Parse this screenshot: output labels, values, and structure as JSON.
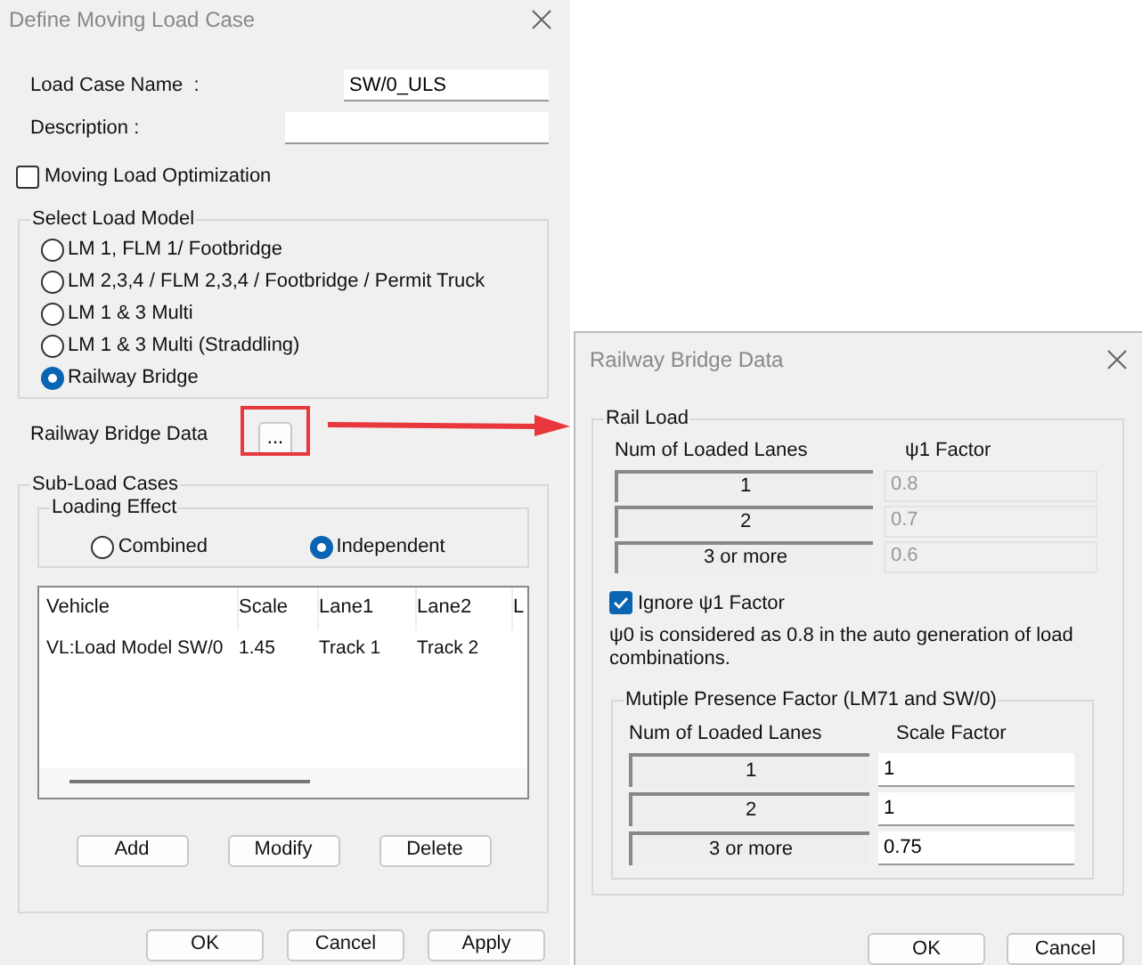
{
  "main_dialog": {
    "title": "Define Moving Load Case",
    "load_case_name": {
      "label": "Load Case Name  :",
      "value": "SW/0_ULS"
    },
    "description": {
      "label": "Description :"
    },
    "optimization": {
      "label": "Moving Load Optimization",
      "checked": false
    },
    "load_model": {
      "title": "Select Load Model",
      "options": [
        {
          "label": "LM 1, FLM 1/ Footbridge",
          "selected": false
        },
        {
          "label": "LM 2,3,4 / FLM 2,3,4 / Footbridge / Permit Truck",
          "selected": false
        },
        {
          "label": "LM 1 & 3 Multi",
          "selected": false
        },
        {
          "label": "LM 1 & 3 Multi (Straddling)",
          "selected": false
        },
        {
          "label": "Railway Bridge",
          "selected": true
        }
      ]
    },
    "railway_data": {
      "label": "Railway Bridge Data",
      "button": "..."
    },
    "sub_load_cases": {
      "title": "Sub-Load Cases",
      "loading_effect": {
        "title": "Loading Effect",
        "options": [
          {
            "label": "Combined",
            "selected": false
          },
          {
            "label": "Independent",
            "selected": true
          }
        ]
      },
      "table": {
        "columns": [
          "Vehicle",
          "Scale",
          "Lane1",
          "Lane2",
          "L"
        ],
        "rows": [
          [
            "VL:Load Model SW/0",
            "1.45",
            "Track 1",
            "Track 2",
            ""
          ]
        ]
      },
      "buttons": [
        "Add",
        "Modify",
        "Delete"
      ]
    },
    "buttons": [
      "OK",
      "Cancel",
      "Apply"
    ]
  },
  "railway_dialog": {
    "title": "Railway Bridge Data",
    "rail_load": {
      "title": "Rail Load",
      "columns": [
        "Num of Loaded Lanes",
        "ψ1 Factor"
      ],
      "rows": [
        {
          "lanes": "1",
          "factor": "0.8"
        },
        {
          "lanes": "2",
          "factor": "0.7"
        },
        {
          "lanes": "3 or more",
          "factor": "0.6"
        }
      ],
      "factors_disabled": true,
      "ignore": {
        "label": "Ignore ψ1 Factor",
        "checked": true
      },
      "note": "ψ0 is considered as 0.8 in the auto generation of load combinations.",
      "presence": {
        "title": "Mutiple Presence Factor (LM71 and SW/0)",
        "columns": [
          "Num of Loaded Lanes",
          "Scale Factor"
        ],
        "rows": [
          {
            "lanes": "1",
            "factor": "1"
          },
          {
            "lanes": "2",
            "factor": "1"
          },
          {
            "lanes": "3 or more",
            "factor": "0.75"
          }
        ]
      }
    },
    "buttons": [
      "OK",
      "Cancel"
    ]
  }
}
